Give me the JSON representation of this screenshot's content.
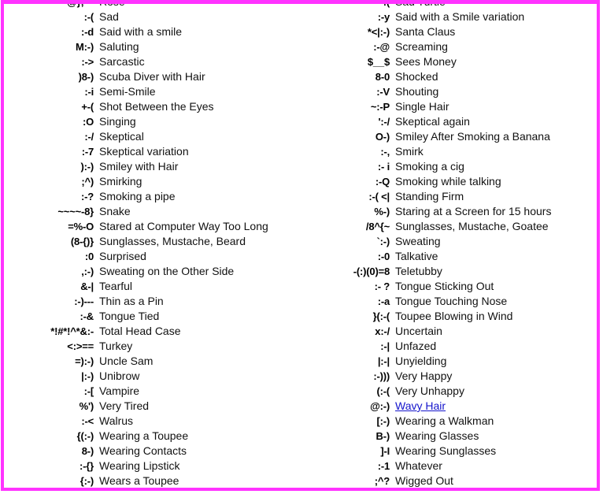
{
  "page": {
    "border_color": "#ff33ff",
    "background_color": "#ffffff",
    "text_color": "#111111",
    "link_color": "#1414cc"
  },
  "left_column": [
    {
      "code": "@};---",
      "desc": "Rose"
    },
    {
      "code": ":-(",
      "desc": "Sad"
    },
    {
      "code": ":-d",
      "desc": "Said with a smile"
    },
    {
      "code": "M:-)",
      "desc": "Saluting"
    },
    {
      "code": ":->",
      "desc": "Sarcastic"
    },
    {
      "code": ")8-)",
      "desc": "Scuba Diver with Hair"
    },
    {
      "code": ":-i",
      "desc": "Semi-Smile"
    },
    {
      "code": "+-(",
      "desc": "Shot Between the Eyes"
    },
    {
      "code": ":O",
      "desc": "Singing"
    },
    {
      "code": ":-/",
      "desc": "Skeptical"
    },
    {
      "code": ":-7",
      "desc": "Skeptical variation"
    },
    {
      "code": "):-)",
      "desc": "Smiley with Hair"
    },
    {
      "code": ";^)",
      "desc": "Smirking"
    },
    {
      "code": ":-?",
      "desc": "Smoking a pipe"
    },
    {
      "code": "~~~~-8}",
      "desc": "Snake"
    },
    {
      "code": "=%-O",
      "desc": "Stared at Computer Way Too Long"
    },
    {
      "code": "(8-{)}",
      "desc": "Sunglasses, Mustache, Beard"
    },
    {
      "code": ":0",
      "desc": "Surprised"
    },
    {
      "code": ",:-)",
      "desc": "Sweating on the Other Side"
    },
    {
      "code": "&-|",
      "desc": "Tearful"
    },
    {
      "code": ":-)---",
      "desc": "Thin as a Pin"
    },
    {
      "code": ":-&",
      "desc": "Tongue Tied"
    },
    {
      "code": "*!#*!^*&:-",
      "desc": "Total Head Case"
    },
    {
      "code": "<:>==",
      "desc": "Turkey"
    },
    {
      "code": "=):-)",
      "desc": "Uncle Sam"
    },
    {
      "code": "|:-)",
      "desc": "Unibrow"
    },
    {
      "code": ":-[",
      "desc": "Vampire"
    },
    {
      "code": "%')",
      "desc": "Very Tired"
    },
    {
      "code": ":-<",
      "desc": "Walrus"
    },
    {
      "code": "{(:-)",
      "desc": "Wearing a Toupee"
    },
    {
      "code": "8-)",
      "desc": "Wearing Contacts"
    },
    {
      "code": ":-{}",
      "desc": "Wearing Lipstick"
    },
    {
      "code": "{:-)",
      "desc": "Wears a Toupee"
    }
  ],
  "right_column": [
    {
      "code": ":(",
      "desc": "Sad Turtle"
    },
    {
      "code": ":-y",
      "desc": "Said with a Smile variation"
    },
    {
      "code": "*<|:-)",
      "desc": "Santa Claus"
    },
    {
      "code": ":-@",
      "desc": "Screaming"
    },
    {
      "code": "$__$",
      "desc": "Sees Money"
    },
    {
      "code": "8-0",
      "desc": "Shocked"
    },
    {
      "code": ":-V",
      "desc": "Shouting"
    },
    {
      "code": "~:-P",
      "desc": "Single Hair"
    },
    {
      "code": "':-/",
      "desc": "Skeptical again"
    },
    {
      "code": "O-)",
      "desc": "Smiley After Smoking a Banana"
    },
    {
      "code": ":-,",
      "desc": "Smirk"
    },
    {
      "code": ":- i",
      "desc": "Smoking a cig"
    },
    {
      "code": ":-Q",
      "desc": "Smoking while talking"
    },
    {
      "code": ":-( <|",
      "desc": "Standing Firm"
    },
    {
      "code": "%-)",
      "desc": "Staring at a Screen for 15 hours"
    },
    {
      "code": "/8^{~",
      "desc": "Sunglasses, Mustache, Goatee"
    },
    {
      "code": "`:-)",
      "desc": "Sweating"
    },
    {
      "code": ":-0",
      "desc": "Talkative"
    },
    {
      "code": "-(:)(0)=8",
      "desc": "Teletubby"
    },
    {
      "code": ":- ?",
      "desc": "Tongue Sticking Out"
    },
    {
      "code": ":-a",
      "desc": "Tongue Touching Nose"
    },
    {
      "code": "}(:-(",
      "desc": "Toupee Blowing in Wind"
    },
    {
      "code": "x:-/",
      "desc": "Uncertain"
    },
    {
      "code": ":-|",
      "desc": "Unfazed"
    },
    {
      "code": "|:-|",
      "desc": "Unyielding"
    },
    {
      "code": ":-)))",
      "desc": "Very Happy"
    },
    {
      "code": "(:-(",
      "desc": "Very Unhappy"
    },
    {
      "code": "@:-)",
      "desc": "Wavy Hair",
      "link": true
    },
    {
      "code": "[:-)",
      "desc": "Wearing a Walkman"
    },
    {
      "code": "B-)",
      "desc": "Wearing Glasses"
    },
    {
      "code": "]-I",
      "desc": "Wearing Sunglasses"
    },
    {
      "code": ":-1",
      "desc": "Whatever"
    },
    {
      "code": ";^?",
      "desc": "Wigged Out"
    }
  ]
}
